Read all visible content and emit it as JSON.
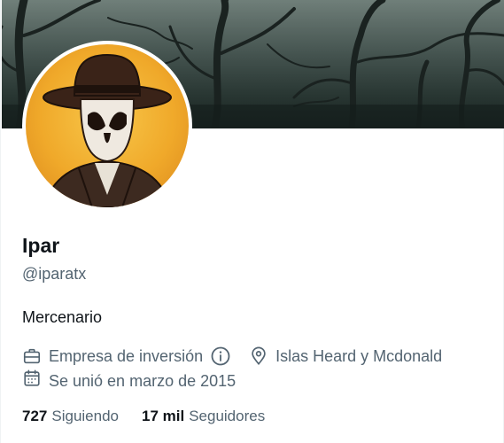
{
  "profile": {
    "name": "Ipar",
    "handle": "@iparatx",
    "bio": "Mercenario"
  },
  "meta": {
    "category": "Empresa de inversión",
    "location": "Islas Heard y Mcdonald",
    "joined": "Se unió en marzo de 2015"
  },
  "stats": {
    "following_count": "727",
    "following_label": "Siguiendo",
    "followers_count": "17 mil",
    "followers_label": "Seguidores"
  },
  "icons": {
    "category": "briefcase-icon",
    "info": "info-icon",
    "location": "location-pin-icon",
    "joined": "calendar-icon"
  },
  "colors": {
    "text_primary": "#0f1419",
    "text_secondary": "#536471",
    "background": "#ffffff"
  }
}
